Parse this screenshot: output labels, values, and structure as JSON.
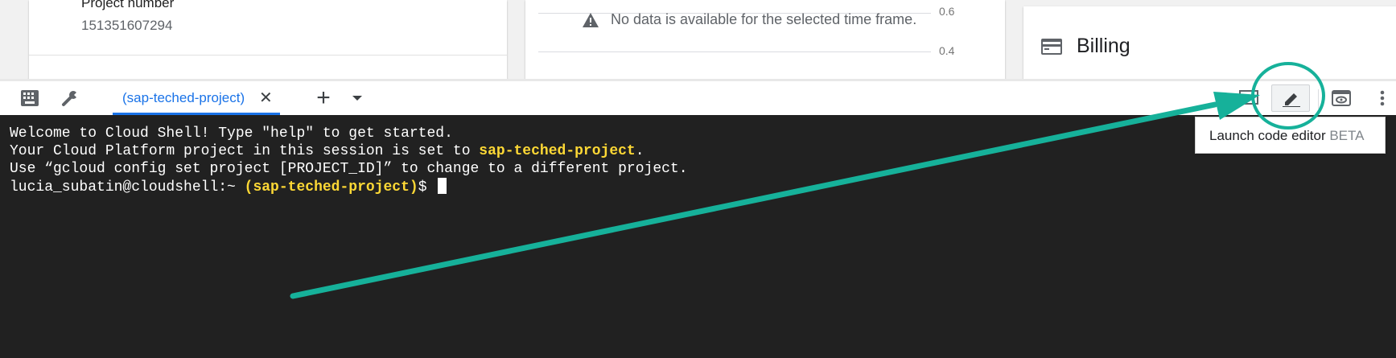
{
  "project_card": {
    "label": "Project number",
    "value": "151351607294"
  },
  "chart_card": {
    "no_data_message": "No data is available for the selected time frame.",
    "ticks": [
      "0.6",
      "0.4"
    ]
  },
  "billing_card": {
    "title": "Billing",
    "icon": "credit-card-icon"
  },
  "shell_toolbar": {
    "left_icons": [
      "keyboard-icon",
      "wrench-icon"
    ],
    "tab_label": "(sap-teched-project)",
    "tab_close": "✕",
    "add_tab": "+",
    "tab_menu": "chevron-down-icon",
    "right_icons": [
      "screen-icon",
      "pencil-icon",
      "web-preview-icon",
      "more-vert-icon"
    ]
  },
  "tooltip": {
    "text": "Launch code editor",
    "badge": "BETA"
  },
  "terminal": {
    "line1": "Welcome to Cloud Shell! Type \"help\" to get started.",
    "line2_prefix": "Your Cloud Platform project in this session is set to ",
    "line2_project": "sap-teched-project",
    "line2_suffix": ".",
    "line3": "Use “gcloud config set project [PROJECT_ID]” to change to a different project.",
    "prompt_user": "lucia_subatin@cloudshell:~ ",
    "prompt_project": "(sap-teched-project)",
    "prompt_symbol": "$ "
  },
  "colors": {
    "accent": "#1a73e8",
    "terminal_bg": "#212121",
    "highlight": "#fdd835",
    "annotation": "#16b19a"
  }
}
